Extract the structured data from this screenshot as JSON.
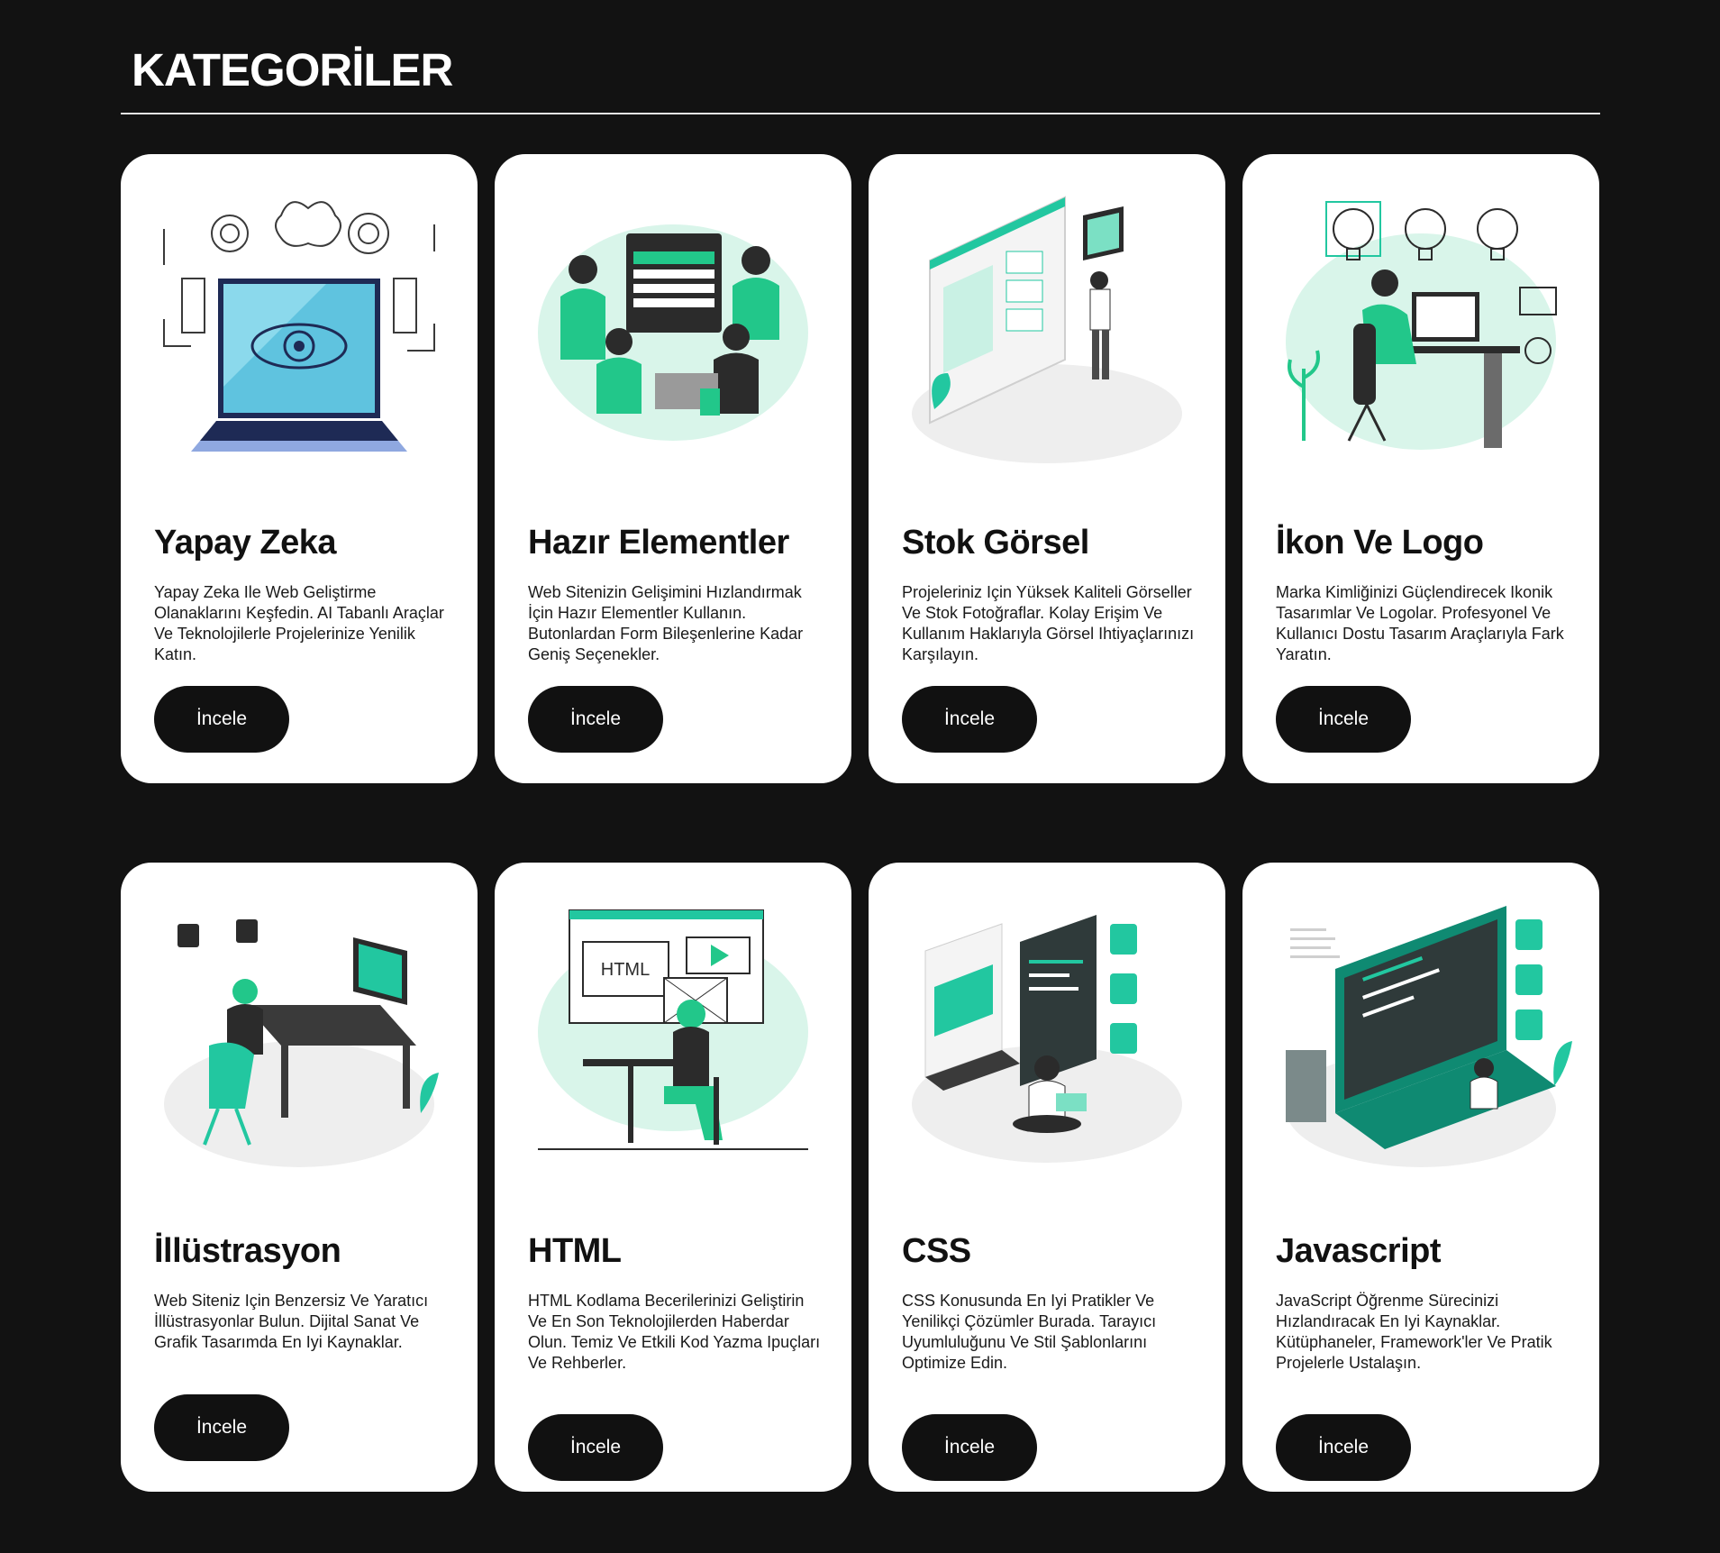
{
  "page": {
    "title": "KATEGORİLER"
  },
  "colors": {
    "background": "#121212",
    "card": "#ffffff",
    "accent": "#22c7a0",
    "button": "#111111"
  },
  "categories": [
    {
      "title": "Yapay Zeka",
      "description": "Yapay Zeka Ile Web Geliştirme Olanaklarını Keşfedin. AI Tabanlı Araçlar Ve Teknolojilerle Projelerinize Yenilik Katın.",
      "button_label": "İncele",
      "illustration": "ai-laptop-eye-illustration"
    },
    {
      "title": "Hazır Elementler",
      "description": "Web Sitenizin Gelişimini Hızlandırmak İçin Hazır Elementler Kullanın. Butonlardan Form Bileşenlerine Kadar Geniş Seçenekler.",
      "button_label": "İncele",
      "illustration": "team-building-ui-illustration"
    },
    {
      "title": "Stok Görsel",
      "description": "Projeleriniz Için Yüksek Kaliteli Görseller Ve Stok Fotoğraflar. Kolay Erişim Ve Kullanım Haklarıyla Görsel Ihtiyaçlarınızı Karşılayın.",
      "button_label": "İncele",
      "illustration": "image-upload-illustration"
    },
    {
      "title": "İkon Ve Logo",
      "description": "Marka Kimliğinizi Güçlendirecek Ikonik Tasarımlar Ve Logolar. Profesyonel Ve Kullanıcı Dostu Tasarım Araçlarıyla Fark Yaratın.",
      "button_label": "İncele",
      "illustration": "designer-lightbulb-illustration"
    },
    {
      "title": "İllüstrasyon",
      "description": "Web Siteniz Için Benzersiz Ve Yaratıcı İllüstrasyonlar Bulun. Dijital Sanat Ve Grafik Tasarımda En Iyi Kaynaklar.",
      "button_label": "İncele",
      "illustration": "illustrator-desk-illustration"
    },
    {
      "title": "HTML",
      "description": "HTML Kodlama Becerilerinizi Geliştirin Ve En Son Teknolojilerden Haberdar Olun. Temiz Ve Etkili Kod Yazma Ipuçları Ve Rehberler.",
      "button_label": "İncele",
      "illustration": "html-coder-illustration",
      "illustration_text": "HTML"
    },
    {
      "title": "CSS",
      "description": "CSS Konusunda En Iyi Pratikler Ve Yenilikçi Çözümler Burada. Tarayıcı Uyumluluğunu Ve Stil Şablonlarını Optimize Edin.",
      "button_label": "İncele",
      "illustration": "css-developer-illustration"
    },
    {
      "title": "Javascript",
      "description": "JavaScript Öğrenme Sürecinizi Hızlandıracak En Iyi Kaynaklar. Kütüphaneler, Framework'ler Ve Pratik Projelerle Ustalaşın.",
      "button_label": "İncele",
      "illustration": "javascript-laptop-illustration"
    }
  ]
}
